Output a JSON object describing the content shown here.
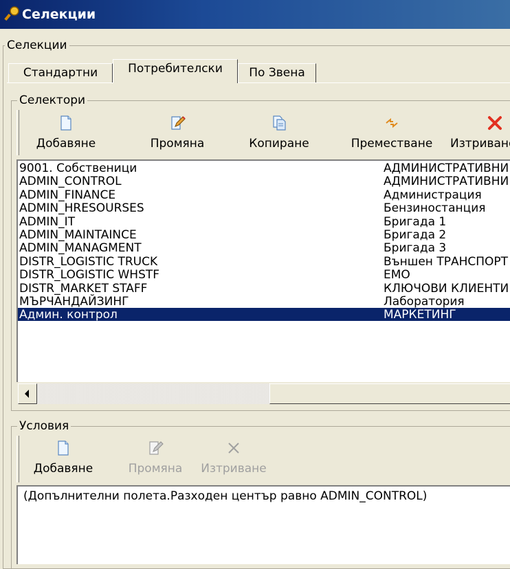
{
  "window": {
    "title": "Селекции"
  },
  "main_group": {
    "legend": "Селекции"
  },
  "tabs": [
    {
      "label": "Стандартни"
    },
    {
      "label": "Потребителски"
    },
    {
      "label": "По Звена"
    }
  ],
  "selectors": {
    "legend": "Селектори",
    "toolbar": {
      "add": "Добавяне",
      "edit": "Промяна",
      "copy": "Копиране",
      "move": "Преместване",
      "delete": "Изтриване"
    },
    "list_left": [
      "9001. Собственици",
      "ADMIN_CONTROL",
      "ADMIN_FINANCE",
      "ADMIN_HRESOURSES",
      "ADMIN_IT",
      "ADMIN_MAINTAINCE",
      "ADMIN_MANAGMENT",
      "DISTR_LOGISTIC TRUCK",
      "DISTR_LOGISTIC WHSTF",
      "DISTR_MARKET STAFF",
      "МЪРЧАНДАЙЗИНГ",
      "Админ. контрол"
    ],
    "list_right": [
      "АДМИНИСТРАТИВНИ",
      "АДМИНИСТРАТИВНИ",
      "Администрация",
      "Бензиностанция",
      "Бригада 1",
      "Бригада 2",
      "Бригада 3",
      "Външен ТРАНСПОРТ",
      "ЕМО",
      "КЛЮЧОВИ КЛИЕНТИ",
      "Лаборатория",
      "МАРКЕТИНГ"
    ],
    "selected_index": 11
  },
  "conditions": {
    "legend": "Условия",
    "toolbar": {
      "add": "Добавяне",
      "edit": "Промяна",
      "delete": "Изтриване"
    },
    "text": "(Допълнителни полета.Разходен център равно ADMIN_CONTROL)"
  },
  "colors": {
    "selection": "#0a246a",
    "window_bg": "#ece9d8",
    "title_bar": "#0a246a"
  }
}
